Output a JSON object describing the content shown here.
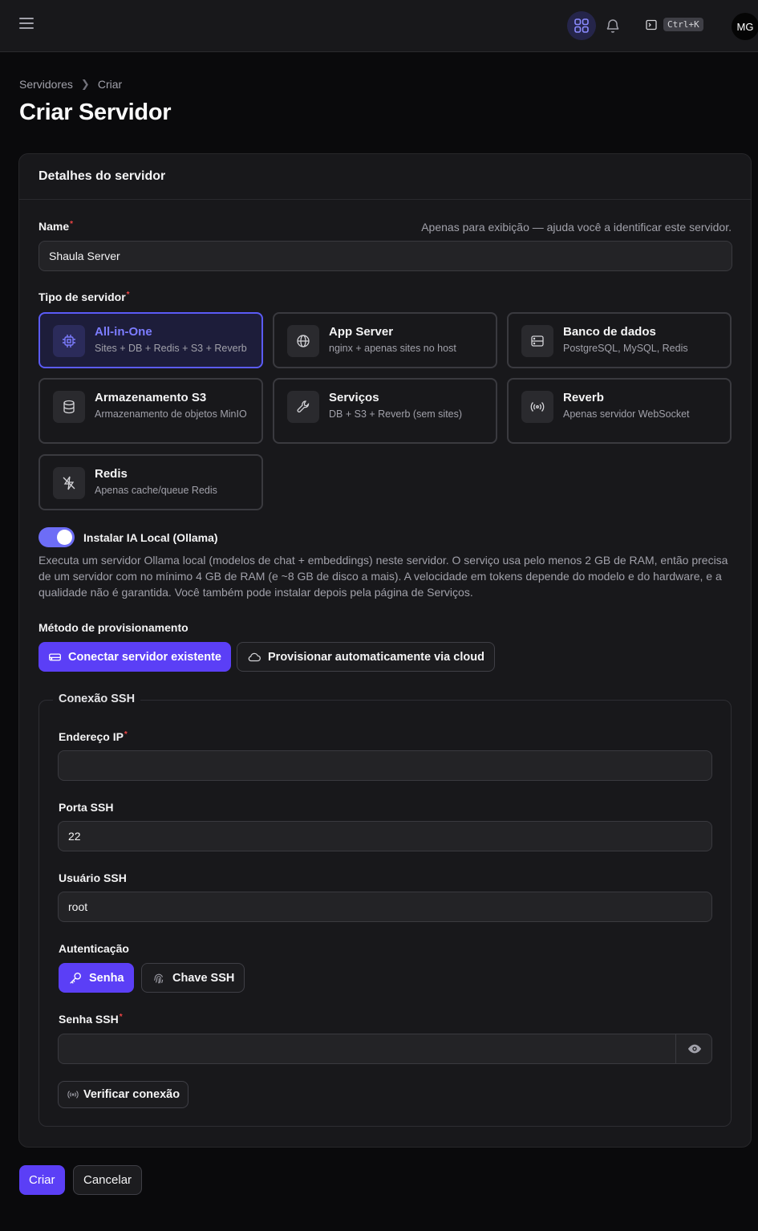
{
  "topbar": {
    "shortcut": "Ctrl+K",
    "avatar_initials": "MG"
  },
  "breadcrumb": {
    "items": [
      "Servidores",
      "Criar"
    ]
  },
  "page_title": "Criar Servidor",
  "card": {
    "title": "Detalhes do servidor",
    "name": {
      "label": "Name",
      "hint": "Apenas para exibição — ajuda você a identificar este servidor.",
      "value": "Shaula Server"
    },
    "server_type": {
      "label": "Tipo de servidor",
      "options": [
        {
          "title": "All-in-One",
          "sub": "Sites + DB + Redis + S3 + Reverb",
          "icon": "cpu-icon",
          "selected": true
        },
        {
          "title": "App Server",
          "sub": "nginx + apenas sites no host",
          "icon": "globe-icon",
          "selected": false
        },
        {
          "title": "Banco de dados",
          "sub": "PostgreSQL, MySQL, Redis",
          "icon": "server-icon",
          "selected": false
        },
        {
          "title": "Armazenamento S3",
          "sub": "Armazenamento de objetos MinIO",
          "icon": "database-icon",
          "selected": false
        },
        {
          "title": "Serviços",
          "sub": "DB + S3 + Reverb (sem sites)",
          "icon": "wrench-icon",
          "selected": false
        },
        {
          "title": "Reverb",
          "sub": "Apenas servidor WebSocket",
          "icon": "broadcast-icon",
          "selected": false
        },
        {
          "title": "Redis",
          "sub": "Apenas cache/queue Redis",
          "icon": "zap-off-icon",
          "selected": false
        }
      ]
    },
    "ollama": {
      "label": "Instalar IA Local (Ollama)",
      "enabled": true,
      "description": "Executa um servidor Ollama local (modelos de chat + embeddings) neste servidor. O serviço usa pelo menos 2 GB de RAM, então precisa de um servidor com no mínimo 4 GB de RAM (e ~8 GB de disco a mais). A velocidade em tokens depende do modelo e do hardware, e a qualidade não é garantida. Você também pode instalar depois pela página de Serviços."
    },
    "provisioning": {
      "label": "Método de provisionamento",
      "connect_existing": "Conectar servidor existente",
      "auto_cloud": "Provisionar automaticamente via cloud"
    },
    "ssh": {
      "legend": "Conexão SSH",
      "ip_label": "Endereço IP",
      "ip_value": "",
      "port_label": "Porta SSH",
      "port_value": "22",
      "user_label": "Usuário SSH",
      "user_value": "root",
      "auth_label": "Autenticação",
      "auth_password": "Senha",
      "auth_key": "Chave SSH",
      "password_label": "Senha SSH",
      "password_value": "",
      "verify_label": "Verificar conexão"
    }
  },
  "actions": {
    "create": "Criar",
    "cancel": "Cancelar"
  },
  "colors": {
    "accent": "#5b3ff6",
    "selected_border": "#5b5bf6",
    "background": "#0a0a0c",
    "card": "#18181b"
  }
}
